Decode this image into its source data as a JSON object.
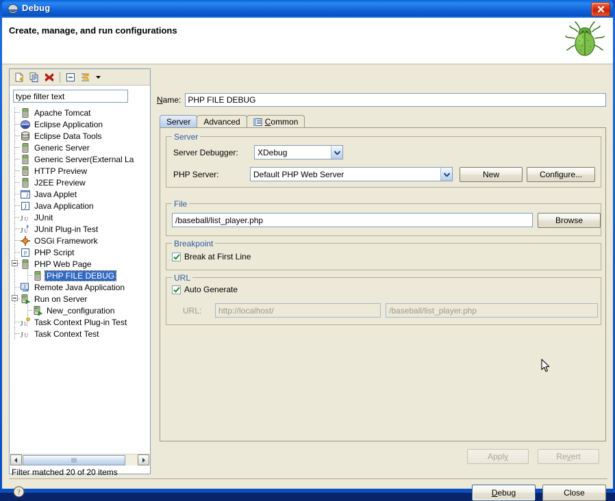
{
  "window": {
    "title": "Debug",
    "title_icon": "eclipse-debug-icon",
    "close_label": "close-icon"
  },
  "banner": {
    "title": "Create, manage, and run configurations",
    "icon": "green-bug-icon"
  },
  "left_panel": {
    "toolbar": [
      {
        "name": "new-launch-configuration-button",
        "icon": "new-document-icon"
      },
      {
        "name": "duplicate-launch-configuration-button",
        "icon": "copy-document-icon"
      },
      {
        "name": "delete-launch-configuration-button",
        "icon": "red-x-delete-icon"
      },
      {
        "name": "collapse-all-button",
        "icon": "collapse-all-icon"
      },
      {
        "name": "filter-launch-configurations-button",
        "icon": "filter-icon"
      },
      {
        "name": "filter-menu-dropdown",
        "icon": "chevron-down-icon"
      }
    ],
    "filter": {
      "value": "type filter text",
      "placeholder": "type filter text"
    },
    "tree": [
      {
        "label": "Apache Tomcat",
        "icon": "server-icon",
        "depth": 1,
        "expander": ""
      },
      {
        "label": "Eclipse Application",
        "icon": "eclipse-sphere-icon",
        "depth": 1,
        "expander": ""
      },
      {
        "label": "Eclipse Data Tools",
        "icon": "database-icon",
        "depth": 1,
        "expander": ""
      },
      {
        "label": "Generic Server",
        "icon": "server-icon",
        "depth": 1,
        "expander": ""
      },
      {
        "label": "Generic Server(External La",
        "icon": "server-icon",
        "depth": 1,
        "expander": ""
      },
      {
        "label": "HTTP Preview",
        "icon": "server-icon",
        "depth": 1,
        "expander": ""
      },
      {
        "label": "J2EE Preview",
        "icon": "server-icon",
        "depth": 1,
        "expander": ""
      },
      {
        "label": "Java Applet",
        "icon": "java-applet-icon",
        "depth": 1,
        "expander": ""
      },
      {
        "label": "Java Application",
        "icon": "java-application-icon",
        "depth": 1,
        "expander": ""
      },
      {
        "label": "JUnit",
        "icon": "junit-icon",
        "depth": 1,
        "expander": ""
      },
      {
        "label": "JUnit Plug-in Test",
        "icon": "junit-plugin-icon",
        "depth": 1,
        "expander": ""
      },
      {
        "label": "OSGi Framework",
        "icon": "osgi-icon",
        "depth": 1,
        "expander": ""
      },
      {
        "label": "PHP Script",
        "icon": "php-script-icon",
        "depth": 1,
        "expander": ""
      },
      {
        "label": "PHP Web Page",
        "icon": "server-icon",
        "depth": 1,
        "expander": "collapse"
      },
      {
        "label": "PHP FILE DEBUG",
        "icon": "server-icon",
        "depth": 2,
        "expander": "",
        "selected": true
      },
      {
        "label": "Remote Java Application",
        "icon": "remote-java-icon",
        "depth": 1,
        "expander": ""
      },
      {
        "label": "Run on Server",
        "icon": "run-on-server-icon",
        "depth": 1,
        "expander": "collapse"
      },
      {
        "label": "New_configuration",
        "icon": "run-on-server-icon",
        "depth": 2,
        "expander": ""
      },
      {
        "label": "Task Context Plug-in Test",
        "icon": "junit-task-icon",
        "depth": 1,
        "expander": ""
      },
      {
        "label": "Task Context Test",
        "icon": "junit-icon",
        "depth": 1,
        "expander": ""
      }
    ],
    "scrollbar": {
      "left_arrow": "scroll-left-icon",
      "right_arrow": "scroll-right-icon"
    },
    "status": "Filter matched 20 of 20 items"
  },
  "config": {
    "name_label": "Name:",
    "name_mnemonic": "N",
    "name_value": "PHP FILE DEBUG",
    "tabs": [
      {
        "label": "Server",
        "active": true,
        "icon": ""
      },
      {
        "label": "Advanced",
        "active": false,
        "icon": ""
      },
      {
        "label": "Common",
        "active": false,
        "icon": "common-list-icon",
        "mnemonic": "C"
      }
    ],
    "server_group": {
      "legend": "Server",
      "debugger_label": "Server Debugger:",
      "debugger_value": "XDebug",
      "php_server_label": "PHP Server:",
      "php_server_value": "Default PHP Web Server",
      "new_button": "New",
      "configure_button": "Configure..."
    },
    "file_group": {
      "legend": "File",
      "file_value": "/baseball/list_player.php",
      "browse_button": "Browse"
    },
    "breakpoint_group": {
      "legend": "Breakpoint",
      "break_first_line_label": "Break at First Line",
      "break_first_line_checked": true
    },
    "url_group": {
      "legend": "URL",
      "auto_generate_label": "Auto Generate",
      "auto_generate_checked": true,
      "url_label": "URL:",
      "url_base_value": "http://localhost/",
      "url_path_value": "/baseball/list_player.php"
    },
    "apply_button": "Apply",
    "apply_mnemonic": "y",
    "revert_button": "Revert",
    "revert_mnemonic": "v"
  },
  "footer": {
    "help_icon": "help-question-icon",
    "debug_button": "Debug",
    "debug_mnemonic": "D",
    "close_button": "Close"
  },
  "colors": {
    "dialog_background": "#ece9d8",
    "title_blue": "#1265dc",
    "selection_blue": "#316ac5",
    "group_label_blue": "#2e5b9e",
    "close_red": "#cb2005",
    "bug_green": "#69b042"
  }
}
